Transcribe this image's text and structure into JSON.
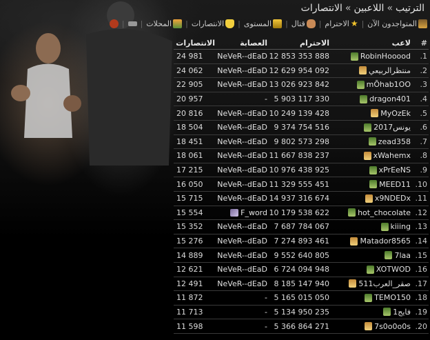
{
  "breadcrumb": {
    "items": [
      "الترتيب",
      "اللاعبين",
      "الانتصارات"
    ],
    "separator": "»"
  },
  "menu": [
    {
      "label": "المتواجدون الآن",
      "icon": "house-icon"
    },
    {
      "label": "الاحترام",
      "icon": "star-icon"
    },
    {
      "label": "قتال",
      "icon": "fist-icon"
    },
    {
      "label": "المستوى",
      "icon": "level-icon"
    },
    {
      "label": "الانتصارات",
      "icon": "trophy-icon"
    },
    {
      "label": "المحلات",
      "icon": "shop-icon"
    },
    {
      "label": "",
      "icon": "gun-icon"
    },
    {
      "label": "",
      "icon": "bomb-icon"
    }
  ],
  "table": {
    "headers": {
      "rank": "#",
      "player": "لاعب",
      "respect": "الاحترام",
      "gang": "العصابة",
      "wins": "الانتصارات"
    },
    "rows": [
      {
        "rank": "1.",
        "player": "RobinHooood",
        "respect": "12 853 353 888",
        "gang": "NeVeR--dEaD",
        "wins": "24 981"
      },
      {
        "rank": "2.",
        "player": "منتظرالربيعي",
        "respect": "12 629 954 092",
        "gang": "NeVeR--dEaD",
        "wins": "24 062"
      },
      {
        "rank": "3.",
        "player": "mŌhab1OO",
        "respect": "13 026 923 842",
        "gang": "NeVeR--dEaD",
        "wins": "22 905"
      },
      {
        "rank": "4.",
        "player": "dragon401",
        "respect": "5 903 117 330",
        "gang": "-",
        "wins": "20 957"
      },
      {
        "rank": "5.",
        "player": "MyOzEk",
        "respect": "10 249 139 428",
        "gang": "NeVeR--dEaD",
        "wins": "20 816"
      },
      {
        "rank": "6.",
        "player": "يونس2017",
        "respect": "9 374 754 516",
        "gang": "NeVeR--dEaD",
        "wins": "18 504"
      },
      {
        "rank": "7.",
        "player": "zead358",
        "respect": "9 802 573 298",
        "gang": "NeVeR--dEaD",
        "wins": "18 451"
      },
      {
        "rank": "8.",
        "player": "xWahemx",
        "respect": "11 667 838 237",
        "gang": "NeVeR--dEaD",
        "wins": "18 061"
      },
      {
        "rank": "9.",
        "player": "xPrEeNS",
        "respect": "10 976 438 925",
        "gang": "NeVeR--dEaD",
        "wins": "17 215"
      },
      {
        "rank": "10.",
        "player": "MEED11",
        "respect": "11 329 555 451",
        "gang": "NeVeR--dEaD",
        "wins": "16 050"
      },
      {
        "rank": "11.",
        "player": "x9NDEDx",
        "respect": "14 937 316 674",
        "gang": "NeVeR--dEaD",
        "wins": "15 715"
      },
      {
        "rank": "12.",
        "player": "hot_chocolate",
        "respect": "10 179 538 622",
        "gang": "F_word",
        "wins": "15 554"
      },
      {
        "rank": "13.",
        "player": "kiiing",
        "respect": "7 687 784 067",
        "gang": "NeVeR--dEaD",
        "wins": "15 352"
      },
      {
        "rank": "14.",
        "player": "Matador8565",
        "respect": "7 274 893 461",
        "gang": "NeVeR--dEaD",
        "wins": "15 276"
      },
      {
        "rank": "15.",
        "player": "7laa",
        "respect": "9 552 640 805",
        "gang": "NeVeR--dEaD",
        "wins": "14 889"
      },
      {
        "rank": "16.",
        "player": "XOTWOD",
        "respect": "6 724 094 948",
        "gang": "NeVeR--dEaD",
        "wins": "12 621"
      },
      {
        "rank": "17.",
        "player": "صقر_العرب511",
        "respect": "8 185 147 940",
        "gang": "NeVeR--dEaD",
        "wins": "12 491"
      },
      {
        "rank": "18.",
        "player": "TEMO150",
        "respect": "5 165 015 050",
        "gang": "-",
        "wins": "11 872"
      },
      {
        "rank": "19.",
        "player": "فايج1",
        "respect": "5 134 950 235",
        "gang": "-",
        "wins": "11 713"
      },
      {
        "rank": "20.",
        "player": "7s0o0o0s",
        "respect": "5 366 864 271",
        "gang": "-",
        "wins": "11 598"
      }
    ]
  },
  "colors": {
    "background": "#000000",
    "text": "#dddddd",
    "row_border": "#3a3a3a"
  }
}
